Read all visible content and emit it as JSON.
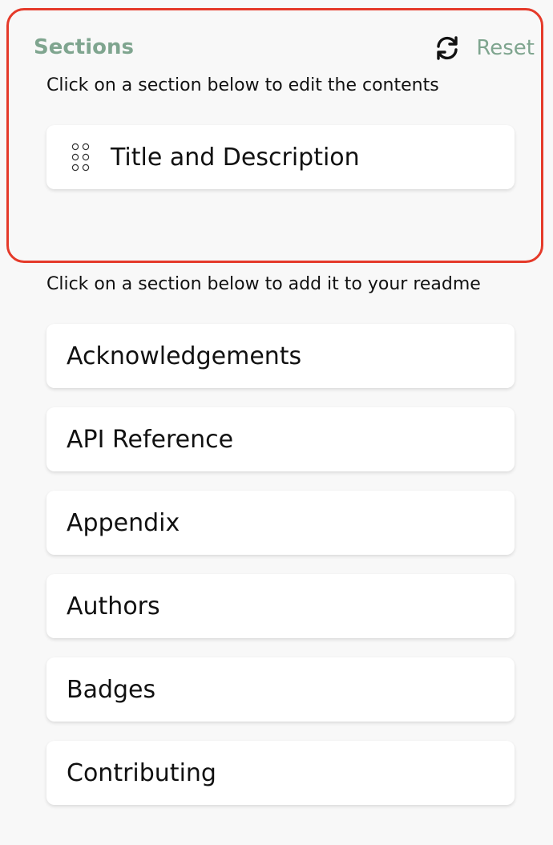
{
  "header": {
    "title": "Sections",
    "reset_label": "Reset"
  },
  "hints": {
    "edit": "Click on a section below to edit the contents",
    "add": "Click on a section below to add it to your readme"
  },
  "active_sections": [
    {
      "label": "Title and Description"
    }
  ],
  "available_sections": [
    {
      "label": "Acknowledgements"
    },
    {
      "label": "API Reference"
    },
    {
      "label": "Appendix"
    },
    {
      "label": "Authors"
    },
    {
      "label": "Badges"
    },
    {
      "label": "Contributing"
    }
  ],
  "colors": {
    "accent": "#7fa58f",
    "highlight_border": "#e53a2a",
    "card_bg": "#ffffff",
    "page_bg": "#f8f8f8"
  },
  "icons": {
    "reset": "refresh-icon",
    "drag": "drag-handle-icon"
  }
}
